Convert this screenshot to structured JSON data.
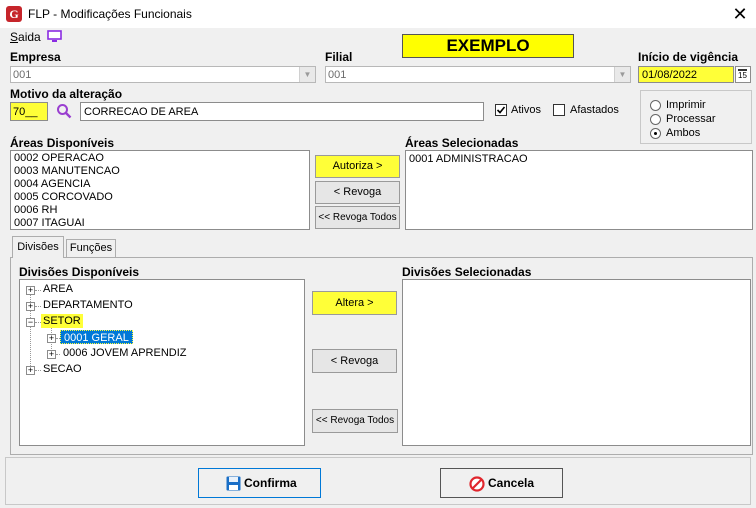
{
  "window": {
    "title": "FLP - Modificações Funcionais",
    "logo": "G",
    "close": "✕"
  },
  "menu": {
    "saida_prefix": "S",
    "saida_rest": "aida"
  },
  "banner": "EXEMPLO",
  "empresa": {
    "label": "Empresa",
    "value": "001"
  },
  "filial": {
    "label": "Filial",
    "value": "001"
  },
  "vigencia": {
    "label": "Início de vigência",
    "value": "01/08/2022",
    "cal_day": "15"
  },
  "motivo": {
    "label": "Motivo da alteração",
    "code": "70__",
    "description": "CORRECAO DE AREA"
  },
  "filters": {
    "ativos": {
      "label": "Ativos",
      "checked": true
    },
    "afastados": {
      "label": "Afastados",
      "checked": false
    }
  },
  "action_radio": [
    {
      "label": "Imprimir",
      "selected": false
    },
    {
      "label": "Processar",
      "selected": false
    },
    {
      "label": "Ambos",
      "selected": true
    }
  ],
  "areas": {
    "available_label": "Áreas Disponíveis",
    "selected_label": "Áreas Selecionadas",
    "available": [
      "0002 OPERACAO",
      "0003 MANUTENCAO",
      "0004 AGENCIA",
      "0005 CORCOVADO",
      "0006 RH",
      "0007 ITAGUAI"
    ],
    "selected": [
      "0001 ADMINISTRACAO"
    ],
    "btn_autoriza": "Autoriza >",
    "btn_revoga": "< Revoga",
    "btn_revoga_todos": "<< Revoga Todos"
  },
  "tabs": [
    "Divisões",
    "Funções"
  ],
  "divisoes": {
    "available_label": "Divisões Disponíveis",
    "selected_label": "Divisões Selecionadas",
    "tree": {
      "area": "AREA",
      "departamento": "DEPARTAMENTO",
      "setor": "SETOR",
      "geral": "0001 GERAL",
      "jovem": "0006 JOVEM APRENDIZ",
      "secao": "SECAO"
    },
    "btn_altera": "Altera >",
    "btn_revoga": "< Revoga",
    "btn_revoga_todos": "<< Revoga Todos"
  },
  "footer": {
    "confirma": "Confirma",
    "cancela": "Cancela"
  },
  "colors": {
    "yellow": "#ffff38",
    "selection": "#0078d7",
    "banner": "#ffff00"
  }
}
